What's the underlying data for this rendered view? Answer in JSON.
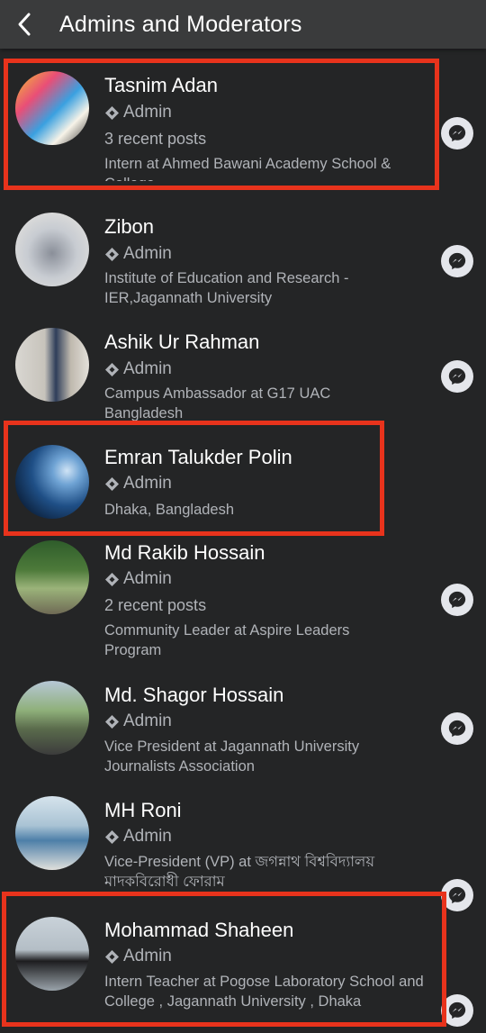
{
  "header": {
    "title": "Admins and Moderators"
  },
  "colors": {
    "background": "#242526",
    "header": "#3a3b3c",
    "highlight": "#e8331c",
    "text_secondary": "#b0b3b8"
  },
  "members": [
    {
      "name": "Tasnim Adan",
      "role": "Admin",
      "posts": "3 recent posts",
      "bio": "Intern at Ahmed Bawani Academy School & College"
    },
    {
      "name": "Zibon",
      "role": "Admin",
      "posts": "",
      "bio": "Institute of Education and Research - IER,Jagannath University"
    },
    {
      "name": "Ashik Ur Rahman",
      "role": "Admin",
      "posts": "",
      "bio": "Campus Ambassador at G17 UAC Bangladesh"
    },
    {
      "name": "Emran Talukder Polin",
      "role": "Admin",
      "posts": "",
      "bio": "Dhaka, Bangladesh"
    },
    {
      "name": "Md Rakib Hossain",
      "role": "Admin",
      "posts": "2 recent posts",
      "bio": "Community Leader at Aspire Leaders Program"
    },
    {
      "name": "Md. Shagor Hossain",
      "role": "Admin",
      "posts": "",
      "bio": "Vice President at Jagannath University Journalists Association"
    },
    {
      "name": "MH Roni",
      "role": "Admin",
      "posts": "",
      "bio": "Vice-President (VP) at জগন্নাথ বিশ্ববিদ্যালয় মাদকবিরোধী ফোরাম"
    },
    {
      "name": "Mohammad Shaheen",
      "role": "Admin",
      "posts": "",
      "bio": "Intern Teacher at Pogose Laboratory School and College , Jagannath University , Dhaka"
    }
  ]
}
